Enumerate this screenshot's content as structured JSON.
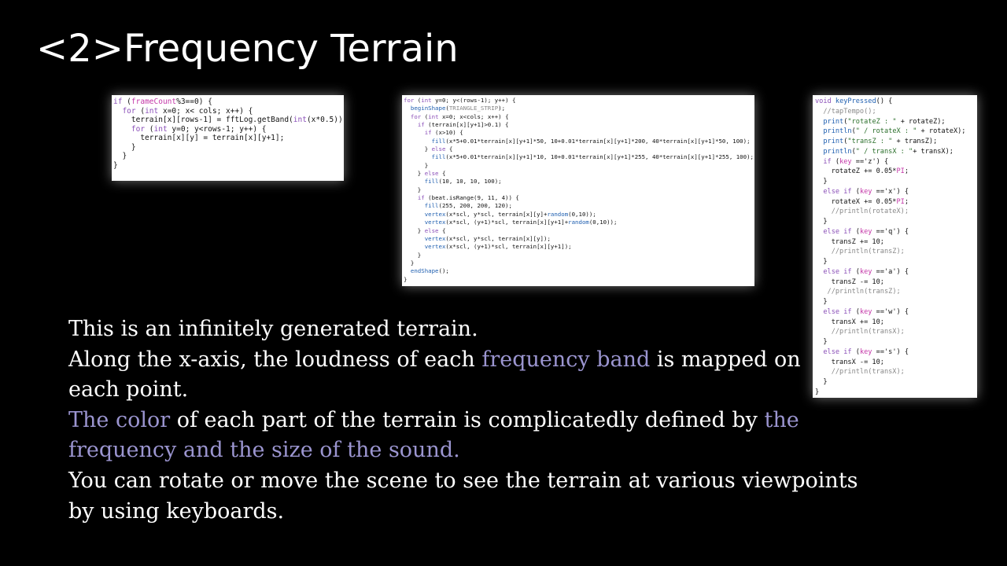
{
  "slide": {
    "title": "<2>Frequency Terrain"
  },
  "code_blocks": {
    "frame_update": [
      [
        {
          "t": "if",
          "c": "kw"
        },
        {
          "t": " ("
        },
        {
          "t": "frameCount",
          "c": "pk"
        },
        {
          "t": "%3==0) {"
        }
      ],
      [
        {
          "t": "  "
        },
        {
          "t": "for",
          "c": "kw"
        },
        {
          "t": " ("
        },
        {
          "t": "int",
          "c": "kw"
        },
        {
          "t": " x=0; x< cols; x++) {"
        }
      ],
      [
        {
          "t": "    terrain[x][rows-1] = fftLog.getBand("
        },
        {
          "t": "int",
          "c": "kw"
        },
        {
          "t": "(x*0.5)) ;"
        }
      ],
      [
        {
          "t": "    "
        },
        {
          "t": "for",
          "c": "kw"
        },
        {
          "t": " ("
        },
        {
          "t": "int",
          "c": "kw"
        },
        {
          "t": " y=0; y<rows-1; y++) {"
        }
      ],
      [
        {
          "t": "      terrain[x][y] = terrain[x][y+1];"
        }
      ],
      [
        {
          "t": "    }"
        }
      ],
      [
        {
          "t": "  }"
        }
      ],
      [
        {
          "t": "}"
        }
      ]
    ],
    "draw_terrain": [
      [
        {
          "t": "for",
          "c": "kw"
        },
        {
          "t": " ("
        },
        {
          "t": "int",
          "c": "kw"
        },
        {
          "t": " y=0; y<(rows-1); y++) {"
        }
      ],
      [
        {
          "t": "  "
        },
        {
          "t": "beginShape",
          "c": "fn"
        },
        {
          "t": "("
        },
        {
          "t": "TRIANGLE_STRIP",
          "c": "cm"
        },
        {
          "t": ");"
        }
      ],
      [
        {
          "t": "  "
        },
        {
          "t": "for",
          "c": "kw"
        },
        {
          "t": " ("
        },
        {
          "t": "int",
          "c": "kw"
        },
        {
          "t": " x=0; x<cols; x++) {"
        }
      ],
      [
        {
          "t": "    "
        },
        {
          "t": "if",
          "c": "kw"
        },
        {
          "t": " (terrain[x][y+1]>0.1) {"
        }
      ],
      [
        {
          "t": "      "
        },
        {
          "t": "if",
          "c": "kw"
        },
        {
          "t": " (x>10) {"
        }
      ],
      [
        {
          "t": "        "
        },
        {
          "t": "fill",
          "c": "fn"
        },
        {
          "t": "(x*5+0.01*terrain[x][y+1]*50, 10+0.01*terrain[x][y+1]*200, 40*terrain[x][y+1]*50, 100);"
        }
      ],
      [
        {
          "t": "      } "
        },
        {
          "t": "else",
          "c": "kw"
        },
        {
          "t": " {"
        }
      ],
      [
        {
          "t": "        "
        },
        {
          "t": "fill",
          "c": "fn"
        },
        {
          "t": "(x*5+0.01*terrain[x][y+1]*10, 10+0.01*terrain[x][y+1]*255, 40*terrain[x][y+1]*255, 100);"
        }
      ],
      [
        {
          "t": "      }"
        }
      ],
      [
        {
          "t": "    } "
        },
        {
          "t": "else",
          "c": "kw"
        },
        {
          "t": " {"
        }
      ],
      [
        {
          "t": "      "
        },
        {
          "t": "fill",
          "c": "fn"
        },
        {
          "t": "(10, 10, 10, 100);"
        }
      ],
      [
        {
          "t": "    }"
        }
      ],
      [
        {
          "t": "    "
        },
        {
          "t": "if",
          "c": "kw"
        },
        {
          "t": " (beat.isRange(9, 11, 4)) {"
        }
      ],
      [
        {
          "t": "      "
        },
        {
          "t": "fill",
          "c": "fn"
        },
        {
          "t": "(255, 200, 200, 120);"
        }
      ],
      [
        {
          "t": "      "
        },
        {
          "t": "vertex",
          "c": "fn"
        },
        {
          "t": "(x*scl, y*scl, terrain[x][y]+"
        },
        {
          "t": "random",
          "c": "fn"
        },
        {
          "t": "(0,10));"
        }
      ],
      [
        {
          "t": "      "
        },
        {
          "t": "vertex",
          "c": "fn"
        },
        {
          "t": "(x*scl, (y+1)*scl, terrain[x][y+1]+"
        },
        {
          "t": "random",
          "c": "fn"
        },
        {
          "t": "(0,10));"
        }
      ],
      [
        {
          "t": "    } "
        },
        {
          "t": "else",
          "c": "kw"
        },
        {
          "t": " {"
        }
      ],
      [
        {
          "t": "      "
        },
        {
          "t": "vertex",
          "c": "fn"
        },
        {
          "t": "(x*scl, y*scl, terrain[x][y]);"
        }
      ],
      [
        {
          "t": "      "
        },
        {
          "t": "vertex",
          "c": "fn"
        },
        {
          "t": "(x*scl, (y+1)*scl, terrain[x][y+1]);"
        }
      ],
      [
        {
          "t": "    }"
        }
      ],
      [
        {
          "t": "  }"
        }
      ],
      [
        {
          "t": "  "
        },
        {
          "t": "endShape",
          "c": "fn"
        },
        {
          "t": "();"
        }
      ],
      [
        {
          "t": "}"
        }
      ]
    ],
    "key_pressed": [
      [
        {
          "t": "void",
          "c": "kw"
        },
        {
          "t": " "
        },
        {
          "t": "keyPressed",
          "c": "fn"
        },
        {
          "t": "() {"
        }
      ],
      [
        {
          "t": "  "
        },
        {
          "t": "//tapTempo();",
          "c": "cm"
        }
      ],
      [
        {
          "t": "  "
        },
        {
          "t": "print",
          "c": "fn"
        },
        {
          "t": "("
        },
        {
          "t": "\"rotateZ : \"",
          "c": "str"
        },
        {
          "t": " + rotateZ);"
        }
      ],
      [
        {
          "t": "  "
        },
        {
          "t": "println",
          "c": "fn"
        },
        {
          "t": "("
        },
        {
          "t": "\" / rotateX : \"",
          "c": "str"
        },
        {
          "t": " + rotateX);"
        }
      ],
      [
        {
          "t": "  "
        },
        {
          "t": "print",
          "c": "fn"
        },
        {
          "t": "("
        },
        {
          "t": "\"transZ : \"",
          "c": "str"
        },
        {
          "t": " + transZ);"
        }
      ],
      [
        {
          "t": "  "
        },
        {
          "t": "println",
          "c": "fn"
        },
        {
          "t": "("
        },
        {
          "t": "\" / transX : \"",
          "c": "str"
        },
        {
          "t": "+ transX);"
        }
      ],
      [
        {
          "t": "  "
        },
        {
          "t": "if",
          "c": "kw"
        },
        {
          "t": " ("
        },
        {
          "t": "key",
          "c": "pk"
        },
        {
          "t": " =='z') {"
        }
      ],
      [
        {
          "t": "    rotateZ += 0.05*"
        },
        {
          "t": "PI",
          "c": "pk"
        },
        {
          "t": ";"
        }
      ],
      [
        {
          "t": "  }"
        }
      ],
      [
        {
          "t": "  "
        },
        {
          "t": "else if",
          "c": "kw"
        },
        {
          "t": " ("
        },
        {
          "t": "key",
          "c": "pk"
        },
        {
          "t": " =='x') {"
        }
      ],
      [
        {
          "t": "    rotateX += 0.05*"
        },
        {
          "t": "PI",
          "c": "pk"
        },
        {
          "t": ";"
        }
      ],
      [
        {
          "t": "    "
        },
        {
          "t": "//println(rotateX);",
          "c": "cm"
        }
      ],
      [
        {
          "t": "  }"
        }
      ],
      [
        {
          "t": "  "
        },
        {
          "t": "else if",
          "c": "kw"
        },
        {
          "t": " ("
        },
        {
          "t": "key",
          "c": "pk"
        },
        {
          "t": " =='q') {"
        }
      ],
      [
        {
          "t": "    transZ += 10;"
        }
      ],
      [
        {
          "t": "    "
        },
        {
          "t": "//println(transZ);",
          "c": "cm"
        }
      ],
      [
        {
          "t": "  }"
        }
      ],
      [
        {
          "t": "  "
        },
        {
          "t": "else if",
          "c": "kw"
        },
        {
          "t": " ("
        },
        {
          "t": "key",
          "c": "pk"
        },
        {
          "t": " =='a') {"
        }
      ],
      [
        {
          "t": "    transZ -= 10;"
        }
      ],
      [
        {
          "t": "   "
        },
        {
          "t": "//println(transZ);",
          "c": "cm"
        }
      ],
      [
        {
          "t": "  }"
        }
      ],
      [
        {
          "t": "  "
        },
        {
          "t": "else if",
          "c": "kw"
        },
        {
          "t": " ("
        },
        {
          "t": "key",
          "c": "pk"
        },
        {
          "t": " =='w') {"
        }
      ],
      [
        {
          "t": "    transX += 10;"
        }
      ],
      [
        {
          "t": "    "
        },
        {
          "t": "//println(transX);",
          "c": "cm"
        }
      ],
      [
        {
          "t": "  }"
        }
      ],
      [
        {
          "t": "  "
        },
        {
          "t": "else if",
          "c": "kw"
        },
        {
          "t": " ("
        },
        {
          "t": "key",
          "c": "pk"
        },
        {
          "t": " =='s') {"
        }
      ],
      [
        {
          "t": "    transX -= 10;"
        }
      ],
      [
        {
          "t": "    "
        },
        {
          "t": "//println(transX);",
          "c": "cm"
        }
      ],
      [
        {
          "t": "  }"
        }
      ],
      [
        {
          "t": "}"
        }
      ]
    ]
  },
  "description": [
    [
      {
        "t": "This is an infinitely generated terrain."
      }
    ],
    [
      {
        "t": "Along the x-axis, the loudness of each "
      },
      {
        "t": "frequency band",
        "h": true
      },
      {
        "t": " is mapped on"
      }
    ],
    [
      {
        "t": "each point."
      }
    ],
    [
      {
        "t": "The color",
        "h": true
      },
      {
        "t": " of each part of the terrain is complicatedly defined by "
      },
      {
        "t": "the",
        "h": true
      }
    ],
    [
      {
        "t": "frequency and the size of the sound.",
        "h": true
      }
    ],
    [
      {
        "t": "You can rotate or move the scene to see the terrain at various viewpoints"
      }
    ],
    [
      {
        "t": "by using keyboards."
      }
    ]
  ],
  "colors": {
    "background": "#000000",
    "text": "#ffffff",
    "highlight": "#9b95d0",
    "code_keyword": "#8a4fb8",
    "code_function": "#1f5fb0",
    "code_builtin": "#c437a8",
    "code_comment": "#888888"
  }
}
